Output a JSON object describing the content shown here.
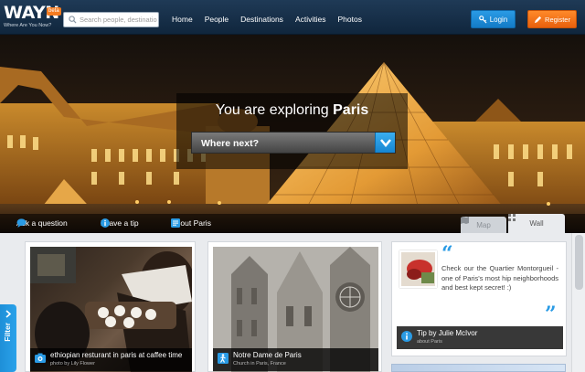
{
  "header": {
    "logo_text": "WAYN",
    "logo_beta": "beta",
    "logo_tagline": "Where Are You Now?",
    "search_placeholder": "Search people, destinatio",
    "nav": [
      "Home",
      "People",
      "Destinations",
      "Activities",
      "Photos"
    ],
    "login_label": "Login",
    "register_label": "Register"
  },
  "hero": {
    "explore_prefix": "You are exploring ",
    "explore_city": "Paris",
    "where_label": "Where next?",
    "ask_label": "Ask a question",
    "tip_label": "Leave a tip",
    "about_label": "About Paris",
    "map_tab": "Map",
    "wall_tab": "Wall"
  },
  "cards": [
    {
      "title": "ethiopian resturant in paris at caffee time",
      "sub": "photo by Lily Flower"
    },
    {
      "title": "Notre Dame de Paris",
      "sub": "Church in Paris, France"
    }
  ],
  "tip": {
    "text": "Check our the Quartier Montorgueil - one of Paris's most hip neighborhoods and best kept secret! :)",
    "by": "Tip by Julie McIvor",
    "sub": "about Paris"
  },
  "filter_label": "Filter",
  "colors": {
    "accent_blue": "#2a9be5",
    "accent_orange": "#f47b20",
    "header_bg": "#1a3350"
  }
}
